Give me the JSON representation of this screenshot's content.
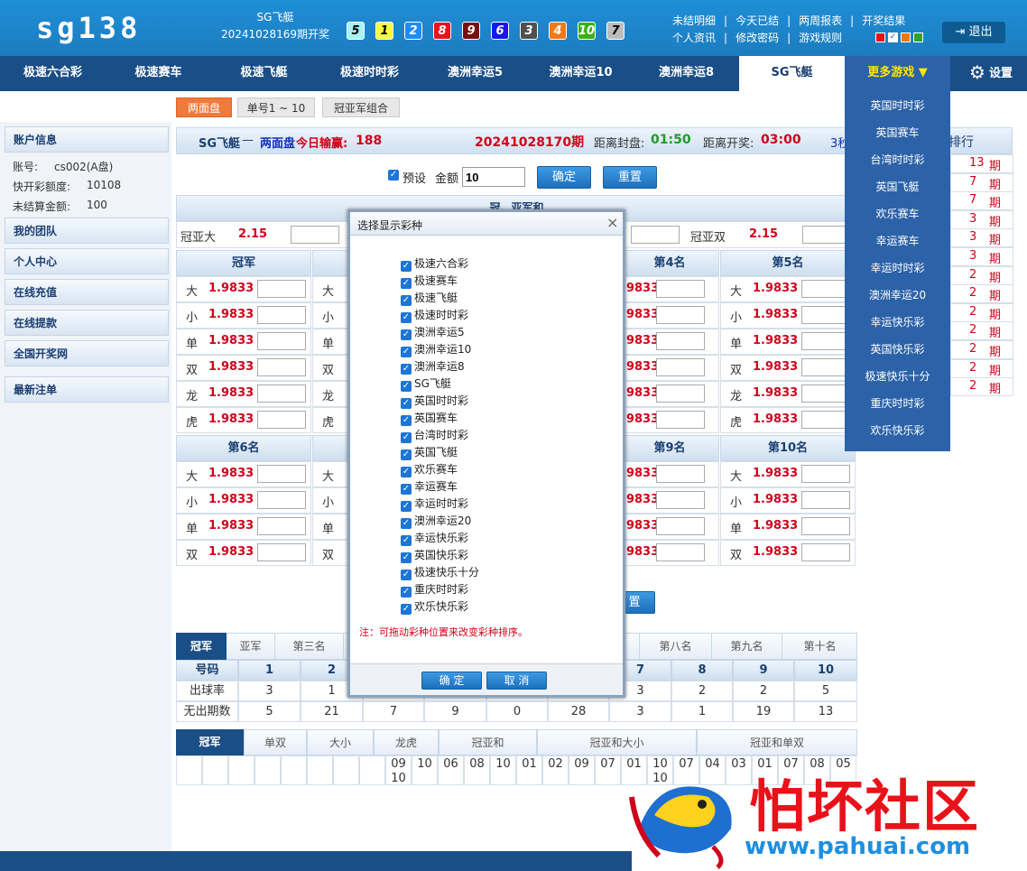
{
  "header": {
    "logo": "sg138",
    "lottery_name": "SG飞艇",
    "draw_text": "20241028169期开奖",
    "balls": [
      {
        "n": "5",
        "bg": "#a4f3f5",
        "fg": "#000"
      },
      {
        "n": "1",
        "bg": "#fdfd3f",
        "fg": "#000"
      },
      {
        "n": "2",
        "bg": "#1d8cf8",
        "fg": "#fff"
      },
      {
        "n": "8",
        "bg": "#e8121b",
        "fg": "#fff"
      },
      {
        "n": "9",
        "bg": "#7b0c10",
        "fg": "#fff"
      },
      {
        "n": "6",
        "bg": "#1717f0",
        "fg": "#fff"
      },
      {
        "n": "3",
        "bg": "#505050",
        "fg": "#fff"
      },
      {
        "n": "4",
        "bg": "#f07a18",
        "fg": "#fff"
      },
      {
        "n": "10",
        "bg": "#3ab312",
        "fg": "#fff"
      },
      {
        "n": "7",
        "bg": "#bcbcbc",
        "fg": "#000"
      }
    ],
    "links_row1": [
      "未结明细",
      "今天已结",
      "两周报表",
      "开奖结果"
    ],
    "links_row2": [
      "个人资讯",
      "修改密码",
      "游戏规则"
    ],
    "logout": "退出"
  },
  "nav": {
    "items": [
      "极速六合彩",
      "极速赛车",
      "极速飞艇",
      "极速时时彩",
      "澳洲幸运5",
      "澳洲幸运10",
      "澳洲幸运8",
      "SG飞艇"
    ],
    "more": "更多游戏 ▼",
    "settings": "设置"
  },
  "subtabs": [
    "两面盘",
    "单号1 ~ 10",
    "冠亚军组合"
  ],
  "sidebar": {
    "account_title": "账户信息",
    "account_label": "账号:",
    "account_value": "cs002(A盘)",
    "quota_label": "快开彩额度:",
    "quota_value": "10108",
    "unsettled_label": "未结算金额:",
    "unsettled_value": "100",
    "menu": [
      "我的团队",
      "个人中心",
      "在线充值",
      "在线提款",
      "全国开奖网",
      "最新注单"
    ]
  },
  "info": {
    "game": "SG飞艇",
    "dash": "—",
    "mode": "两面盘",
    "winloss_label": "今日输赢:",
    "winloss": "188",
    "issue": "20241028170期",
    "close_label": "距离封盘:",
    "close_time": "01:50",
    "draw_label": "距离开奖:",
    "draw_time": "03:00",
    "sec": "3秒",
    "rank": "排行"
  },
  "bet": {
    "preset": "预设",
    "amount_label": "金额",
    "amount": "10",
    "confirm": "确定",
    "reset": "重置",
    "reset2": "置"
  },
  "gyh": {
    "title": "冠、亚军和",
    "big": "冠亚大",
    "big_odds": "2.15",
    "double": "冠亚双",
    "double_odds": "2.15"
  },
  "pos_row1": [
    {
      "title": "冠军",
      "rows": [
        [
          "大",
          "1.9833"
        ],
        [
          "小",
          "1.9833"
        ],
        [
          "单",
          "1.9833"
        ],
        [
          "双",
          "1.9833"
        ],
        [
          "龙",
          "1.9833"
        ],
        [
          "虎",
          "1.9833"
        ]
      ]
    },
    {
      "title": "第4名",
      "rows": [
        [
          "",
          ".9833"
        ],
        [
          "",
          ".9833"
        ],
        [
          "",
          ".9833"
        ],
        [
          "",
          ".9833"
        ],
        [
          "",
          ".9833"
        ],
        [
          "",
          ".9833"
        ]
      ]
    },
    {
      "title": "第5名",
      "rows": [
        [
          "大",
          "1.9833"
        ],
        [
          "小",
          "1.9833"
        ],
        [
          "单",
          "1.9833"
        ],
        [
          "双",
          "1.9833"
        ],
        [
          "龙",
          "1.9833"
        ],
        [
          "虎",
          "1.9833"
        ]
      ]
    }
  ],
  "pos_row1_col2_labels": [
    "大",
    "小",
    "单",
    "双",
    "龙",
    "虎"
  ],
  "pos_row2": [
    {
      "title": "第6名",
      "rows": [
        [
          "大",
          "1.9833"
        ],
        [
          "小",
          "1.9833"
        ],
        [
          "单",
          "1.9833"
        ],
        [
          "双",
          "1.9833"
        ]
      ]
    },
    {
      "title": "第9名",
      "rows": [
        [
          "",
          ".9833"
        ],
        [
          "",
          ".9833"
        ],
        [
          "",
          ".9833"
        ],
        [
          "",
          ".9833"
        ]
      ]
    },
    {
      "title": "第10名",
      "rows": [
        [
          "大",
          "1.9833"
        ],
        [
          "小",
          "1.9833"
        ],
        [
          "单",
          "1.9833"
        ],
        [
          "双",
          "1.9833"
        ]
      ]
    }
  ],
  "pos_row2_col2_labels": [
    "大",
    "小",
    "单",
    "双"
  ],
  "rank": [
    {
      "n": "13",
      "u": "期"
    },
    {
      "n": "7",
      "u": "期"
    },
    {
      "n": "7",
      "u": "期"
    },
    {
      "n": "3",
      "u": "期"
    },
    {
      "n": "3",
      "u": "期"
    },
    {
      "n": "3",
      "u": "期"
    },
    {
      "n": "2",
      "u": "期"
    },
    {
      "n": "2",
      "u": "期"
    },
    {
      "n": "2",
      "u": "期"
    },
    {
      "n": "2",
      "u": "期"
    },
    {
      "n": "2",
      "u": "期"
    },
    {
      "n": "2",
      "u": "期"
    },
    {
      "n": "2",
      "u": "期"
    }
  ],
  "stats": {
    "tabs_left": [
      "冠军",
      "亚军",
      "第三名"
    ],
    "tabs_right": [
      "第八名",
      "第九名",
      "第十名"
    ],
    "header": [
      "号码",
      "1",
      "2",
      "",
      "",
      "",
      "",
      "7",
      "8",
      "9",
      "10"
    ],
    "rate_label": "出球率",
    "rate": [
      "3",
      "1",
      "",
      "",
      "",
      "",
      "3",
      "2",
      "2",
      "5"
    ],
    "miss_label": "无出期数",
    "miss": [
      "5",
      "21",
      "7",
      "9",
      "0",
      "28",
      "3",
      "1",
      "19",
      "13"
    ]
  },
  "trend": {
    "tabs": [
      "冠军",
      "单双",
      "大小",
      "龙虎",
      "冠亚和",
      "冠亚和大小",
      "冠亚和单双"
    ],
    "cells": [
      "09",
      "10",
      "06",
      "08",
      "10",
      "01",
      "02",
      "09",
      "07",
      "01",
      "10",
      "07",
      "04",
      "03",
      "01",
      "07",
      "08",
      "05"
    ],
    "cells2": [
      "10",
      "",
      "",
      "",
      "",
      "",
      "",
      "",
      "",
      "",
      "10",
      "",
      "",
      "",
      "",
      "",
      "",
      ""
    ]
  },
  "dropdown": [
    "英国时时彩",
    "英国赛车",
    "台湾时时彩",
    "英国飞艇",
    "欢乐赛车",
    "幸运赛车",
    "幸运时时彩",
    "澳洲幸运20",
    "幸运快乐彩",
    "英国快乐彩",
    "极速快乐十分",
    "重庆时时彩",
    "欢乐快乐彩"
  ],
  "modal": {
    "title": "选择显示彩种",
    "close": "×",
    "items": [
      "极速六合彩",
      "极速赛车",
      "极速飞艇",
      "极速时时彩",
      "澳洲幸运5",
      "澳洲幸运10",
      "澳洲幸运8",
      "SG飞艇",
      "英国时时彩",
      "英国赛车",
      "台湾时时彩",
      "英国飞艇",
      "欢乐赛车",
      "幸运赛车",
      "幸运时时彩",
      "澳洲幸运20",
      "幸运快乐彩",
      "英国快乐彩",
      "极速快乐十分",
      "重庆时时彩",
      "欢乐快乐彩"
    ],
    "note": "注：可拖动彩种位置来改变彩种排序。",
    "ok": "确 定",
    "cancel": "取 消"
  },
  "watermark": {
    "title": "怕坏社区",
    "url": "www.pahuai.com"
  },
  "colors": {
    "header": "#1f8fd6",
    "nav": "#1a4e86",
    "odds": "#d0021b",
    "accent": "#f07a3a"
  }
}
